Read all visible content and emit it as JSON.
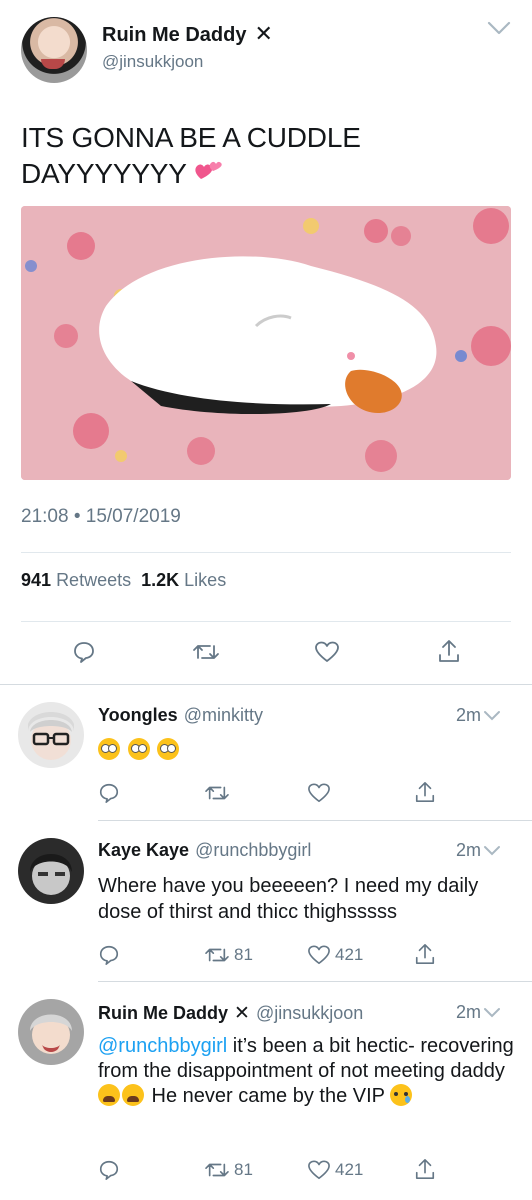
{
  "main_tweet": {
    "display_name": "Ruin Me Daddy",
    "verified_icon": "x-mark-icon",
    "handle": "@jinsukkjoon",
    "text": "ITS GONNA BE A CUDDLE DAYYYYYYY",
    "text_emoji": "two-hearts-emoji",
    "image_description_icon": "cuddle-pillow-image",
    "timestamp": "21:08 • 15/07/2019",
    "retweets_count": "941",
    "retweets_label": "Retweets",
    "likes_count": "1.2K",
    "likes_label": "Likes",
    "actions": [
      "reply-icon",
      "retweet-icon",
      "like-icon",
      "share-icon"
    ]
  },
  "replies": [
    {
      "display_name": "Yoongles",
      "handle": "@minkitty",
      "time": "2m",
      "text": "",
      "emojis": [
        "face-with-rolling-eyes",
        "face-with-rolling-eyes",
        "face-with-rolling-eyes"
      ],
      "retweets": "",
      "likes": ""
    },
    {
      "display_name": "Kaye Kaye",
      "handle": "@runchbbygirl",
      "time": "2m",
      "text": "Where have you beeeeen? I need my daily dose of thirst and thicc thighsssss",
      "retweets": "81",
      "likes": "421"
    },
    {
      "display_name": "Ruin Me Daddy",
      "handle": "@jinsukkjoon",
      "time": "2m",
      "mention": "@runchbbygirl",
      "text_part1": " it’s been a bit hectic- recovering from the disappointment of not meeting daddy ",
      "text_part2": " He never came by the VIP ",
      "retweets": "81",
      "likes": "421"
    }
  ],
  "colors": {
    "text": "#14171a",
    "secondary": "#657786",
    "link": "#1da1f2",
    "divider": "#e1e8ed",
    "image_bg": "#e9b4bb"
  }
}
